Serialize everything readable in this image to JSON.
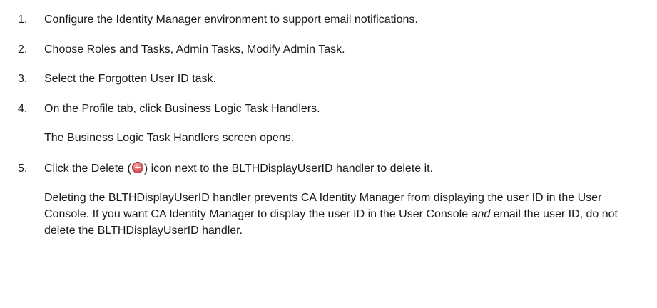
{
  "steps": [
    {
      "number": "1.",
      "text": "Configure the Identity Manager environment to support email notifications."
    },
    {
      "number": "2.",
      "text": "Choose Roles and Tasks, Admin Tasks, Modify Admin Task."
    },
    {
      "number": "3.",
      "text": "Select the Forgotten User ID task."
    },
    {
      "number": "4.",
      "text": "On the Profile tab, click Business Logic Task Handlers.",
      "result": "The Business Logic Task Handlers screen opens."
    },
    {
      "number": "5.",
      "text_before": "Click the Delete (",
      "text_after": ") icon next to the BLTHDisplayUserID handler to delete it.",
      "icon": "delete-icon"
    }
  ],
  "note": {
    "part1": "Deleting the BLTHDisplayUserID handler prevents CA Identity Manager from displaying the user ID in the User Console. If you want CA Identity Manager to display the user ID in the User Console ",
    "emphasis": "and",
    "part2": " email the user ID, do not delete the BLTHDisplayUserID handler."
  }
}
